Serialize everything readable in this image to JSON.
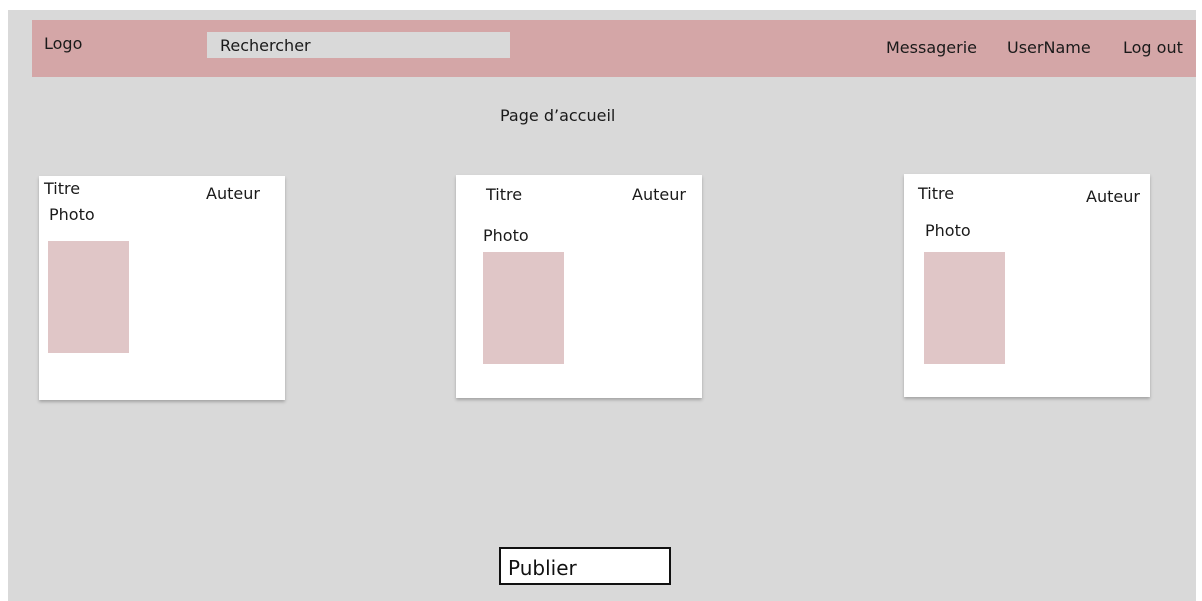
{
  "header": {
    "logo": "Logo",
    "search": {
      "placeholder": "Rechercher"
    },
    "nav": {
      "messagerie": "Messagerie",
      "username": "UserName",
      "logout": "Log out"
    }
  },
  "main": {
    "page_title": "Page d’accueil",
    "posts": [
      {
        "title": "Titre",
        "author": "Auteur",
        "photo_label": "Photo"
      },
      {
        "title": "Titre",
        "author": "Auteur",
        "photo_label": "Photo"
      },
      {
        "title": "Titre",
        "author": "Auteur",
        "photo_label": "Photo"
      }
    ],
    "publish_label": "Publier"
  },
  "colors": {
    "header_bg": "#d4a6a7",
    "page_bg": "#d9d9d9",
    "photo_placeholder": "#e0c6c7",
    "card_bg": "#ffffff"
  }
}
